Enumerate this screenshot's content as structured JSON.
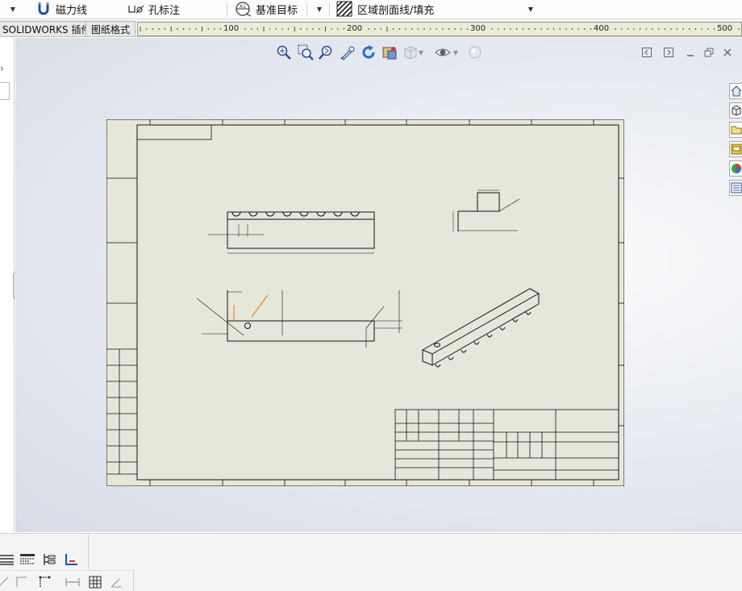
{
  "toolbar": {
    "magnet_line": "磁力线",
    "hole_callout": "孔标注",
    "datum_target": "基准目标",
    "area_hatch": "区域剖面线/填充"
  },
  "tabs": [
    {
      "label": "SOLIDWORKS 插件"
    },
    {
      "label": "图纸格式"
    }
  ],
  "ruler": {
    "labels": [
      "100",
      "200",
      "300",
      "400",
      "500"
    ]
  },
  "colors": {
    "sheet_bg": "#e7e6da",
    "line": "#111111",
    "selected": "#e08a1e",
    "canvas": "#dfe3ea"
  },
  "icons": {
    "hud": [
      "zoom-to-fit-icon",
      "zoom-to-area-icon",
      "previous-view-icon",
      "sketch-pen-icon",
      "rotate-icon",
      "section-view-icon",
      "view-orientation-icon",
      "display-style-icon",
      "hide-show-icon",
      "appearance-icon"
    ],
    "task_pane": [
      "home-icon",
      "3d-parts-icon",
      "file-explorer-icon",
      "design-library-icon",
      "appearances-icon",
      "custom-properties-icon"
    ]
  }
}
